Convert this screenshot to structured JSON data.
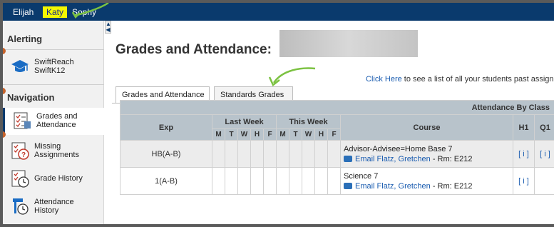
{
  "top_tabs": [
    "Elijah",
    "Katy",
    "Sophy"
  ],
  "active_top_tab": "Katy",
  "sidebar": {
    "alerting_heading": "Alerting",
    "swiftreach_line1": "SwiftReach",
    "swiftreach_line2": "SwiftK12",
    "navigation_heading": "Navigation",
    "items": [
      {
        "label_1": "Grades and",
        "label_2": "Attendance"
      },
      {
        "label_1": "Missing",
        "label_2": "Assignments"
      },
      {
        "label_1": "Grade History",
        "label_2": ""
      },
      {
        "label_1": "Attendance",
        "label_2": "History"
      }
    ]
  },
  "main": {
    "title": "Grades and Attendance:",
    "note_link": "Click Here",
    "note_text": " to see a list of all your students past assignm",
    "tabs": [
      "Grades and Attendance",
      "Standards Grades"
    ],
    "active_tab": "Grades and Attendance"
  },
  "table": {
    "attendance_by_class": "Attendance By Class",
    "headers": {
      "exp": "Exp",
      "last_week": "Last Week",
      "this_week": "This Week",
      "course": "Course",
      "h1": "H1",
      "q1": "Q1"
    },
    "days": [
      "M",
      "T",
      "W",
      "H",
      "F"
    ],
    "rows": [
      {
        "exp": "HB(A-B)",
        "course": "Advisor-Advisee=Home Base 7",
        "email": "Email Flatz, Gretchen",
        "room": " - Rm: E212",
        "h1": "[ i ]",
        "q1": "[ i ]"
      },
      {
        "exp": "1(A-B)",
        "course": "Science 7",
        "email": "Email Flatz, Gretchen",
        "room": " - Rm: E212",
        "h1": "[ i ]",
        "q1": ""
      }
    ]
  },
  "colors": {
    "topbar": "#0a3a6d",
    "active_tab": "#f5f700",
    "link": "#1a5cb0",
    "arrow": "#7cc242",
    "header": "#b8c3cb"
  }
}
